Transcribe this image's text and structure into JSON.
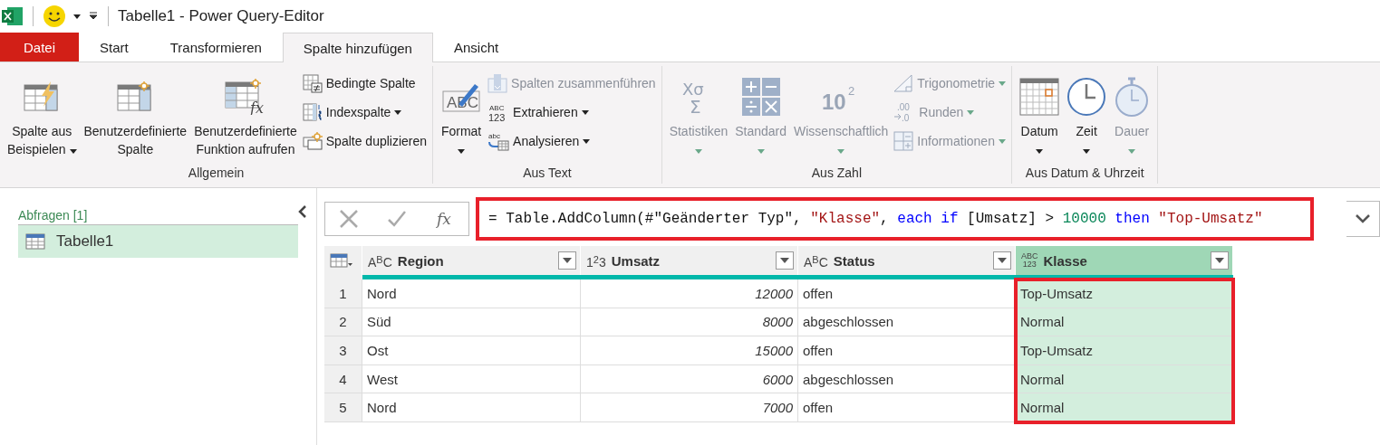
{
  "title_bar": {
    "title": "Tabelle1 - Power Query-Editor"
  },
  "tabs": [
    {
      "label": "Datei",
      "kind": "file",
      "selected": false
    },
    {
      "label": "Start",
      "kind": "tab",
      "selected": false
    },
    {
      "label": "Transformieren",
      "kind": "tab",
      "selected": false
    },
    {
      "label": "Spalte hinzufügen",
      "kind": "tab",
      "selected": true
    },
    {
      "label": "Ansicht",
      "kind": "tab",
      "selected": false
    }
  ],
  "ribbon": [
    {
      "label": "Allgemein",
      "items": [
        {
          "kind": "large",
          "lines": [
            "Spalte aus",
            "Beispielen"
          ],
          "dropdown": true,
          "disabled": false
        },
        {
          "kind": "large",
          "lines": [
            "Benutzerdefinierte",
            "Spalte"
          ],
          "dropdown": false,
          "disabled": false
        },
        {
          "kind": "large",
          "lines": [
            "Benutzerdefinierte",
            "Funktion aufrufen"
          ],
          "dropdown": false,
          "disabled": false,
          "glyph": [
            "fx"
          ]
        },
        {
          "kind": "small",
          "label": "Bedingte Spalte",
          "dropdown": false,
          "disabled": false
        },
        {
          "kind": "small",
          "label": "Indexspalte",
          "dropdown": true,
          "disabled": false
        },
        {
          "kind": "small",
          "label": "Spalte duplizieren",
          "dropdown": false,
          "disabled": false
        }
      ]
    },
    {
      "label": "Aus Text",
      "items": [
        {
          "kind": "large",
          "lines": [
            "Format"
          ],
          "dropdown": true,
          "disabled": false,
          "glyph": [
            "ABC"
          ]
        },
        {
          "kind": "small",
          "label": "Spalten zusammenführen",
          "dropdown": false,
          "disabled": true
        },
        {
          "kind": "small",
          "label": "Extrahieren",
          "dropdown": true,
          "disabled": false,
          "glyph": [
            "ABC",
            "123"
          ]
        },
        {
          "kind": "small",
          "label": "Analysieren",
          "dropdown": true,
          "disabled": false,
          "glyph": [
            "abc"
          ]
        }
      ]
    },
    {
      "label": "Aus Zahl",
      "items": [
        {
          "kind": "large",
          "lines": [
            "Statistiken"
          ],
          "dropdown": true,
          "disabled": true,
          "glyph": [
            "Xσ",
            "Σ"
          ]
        },
        {
          "kind": "large",
          "lines": [
            "Standard"
          ],
          "dropdown": true,
          "disabled": true
        },
        {
          "kind": "large",
          "lines": [
            "Wissenschaftlich"
          ],
          "dropdown": true,
          "disabled": true,
          "glyph": [
            "10",
            "2"
          ]
        },
        {
          "kind": "small",
          "label": "Trigonometrie",
          "dropdown": true,
          "disabled": true
        },
        {
          "kind": "small",
          "label": "Runden",
          "dropdown": true,
          "disabled": true,
          "glyph": [
            ".00",
            ".0"
          ]
        },
        {
          "kind": "small",
          "label": "Informationen",
          "dropdown": true,
          "disabled": true
        }
      ]
    },
    {
      "label": "Aus Datum & Uhrzeit",
      "items": [
        {
          "kind": "large",
          "lines": [
            "Datum"
          ],
          "dropdown": true,
          "disabled": false
        },
        {
          "kind": "large",
          "lines": [
            "Zeit"
          ],
          "dropdown": true,
          "disabled": false
        },
        {
          "kind": "large",
          "lines": [
            "Dauer"
          ],
          "dropdown": true,
          "disabled": true
        }
      ]
    }
  ],
  "queries": {
    "header": "Abfragen [1]",
    "items": [
      {
        "label": "Tabelle1",
        "selected": true
      }
    ]
  },
  "formula": {
    "fx": "fx",
    "highlighted": true,
    "tokens": [
      {
        "text": "= Table.AddColumn(#\"Geänderter Typ\", ",
        "kind": "plain"
      },
      {
        "text": "\"Klasse\"",
        "kind": "string"
      },
      {
        "text": ", ",
        "kind": "plain"
      },
      {
        "text": "each if",
        "kind": "keyword"
      },
      {
        "text": " [Umsatz] > ",
        "kind": "plain"
      },
      {
        "text": "10000",
        "kind": "number"
      },
      {
        "text": " then ",
        "kind": "keyword"
      },
      {
        "text": "\"Top-Umsatz\"",
        "kind": "string"
      }
    ]
  },
  "table": {
    "columns": [
      {
        "name": "Region",
        "kind": "text",
        "type_label": [
          "A$^{B}$C"
        ],
        "selected": false,
        "highlighted": false
      },
      {
        "name": "Umsatz",
        "kind": "number",
        "type_label": [
          "1$^{2}$3"
        ],
        "selected": false,
        "highlighted": false
      },
      {
        "name": "Status",
        "kind": "text",
        "type_label": [
          "A$^{B}$C"
        ],
        "selected": false,
        "highlighted": false
      },
      {
        "name": "Klasse",
        "kind": "any",
        "type_label": [
          "ABC",
          "123"
        ],
        "selected": true,
        "highlighted": true
      }
    ],
    "rows": [
      {
        "number": "1",
        "cells": [
          "Nord",
          "12000",
          "offen",
          "Top-Umsatz"
        ]
      },
      {
        "number": "2",
        "cells": [
          "Süd",
          "8000",
          "abgeschlossen",
          "Normal"
        ]
      },
      {
        "number": "3",
        "cells": [
          "Ost",
          "15000",
          "offen",
          "Top-Umsatz"
        ]
      },
      {
        "number": "4",
        "cells": [
          "West",
          "6000",
          "abgeschlossen",
          "Normal"
        ]
      },
      {
        "number": "5",
        "cells": [
          "Nord",
          "7000",
          "offen",
          "Normal"
        ]
      }
    ]
  }
}
